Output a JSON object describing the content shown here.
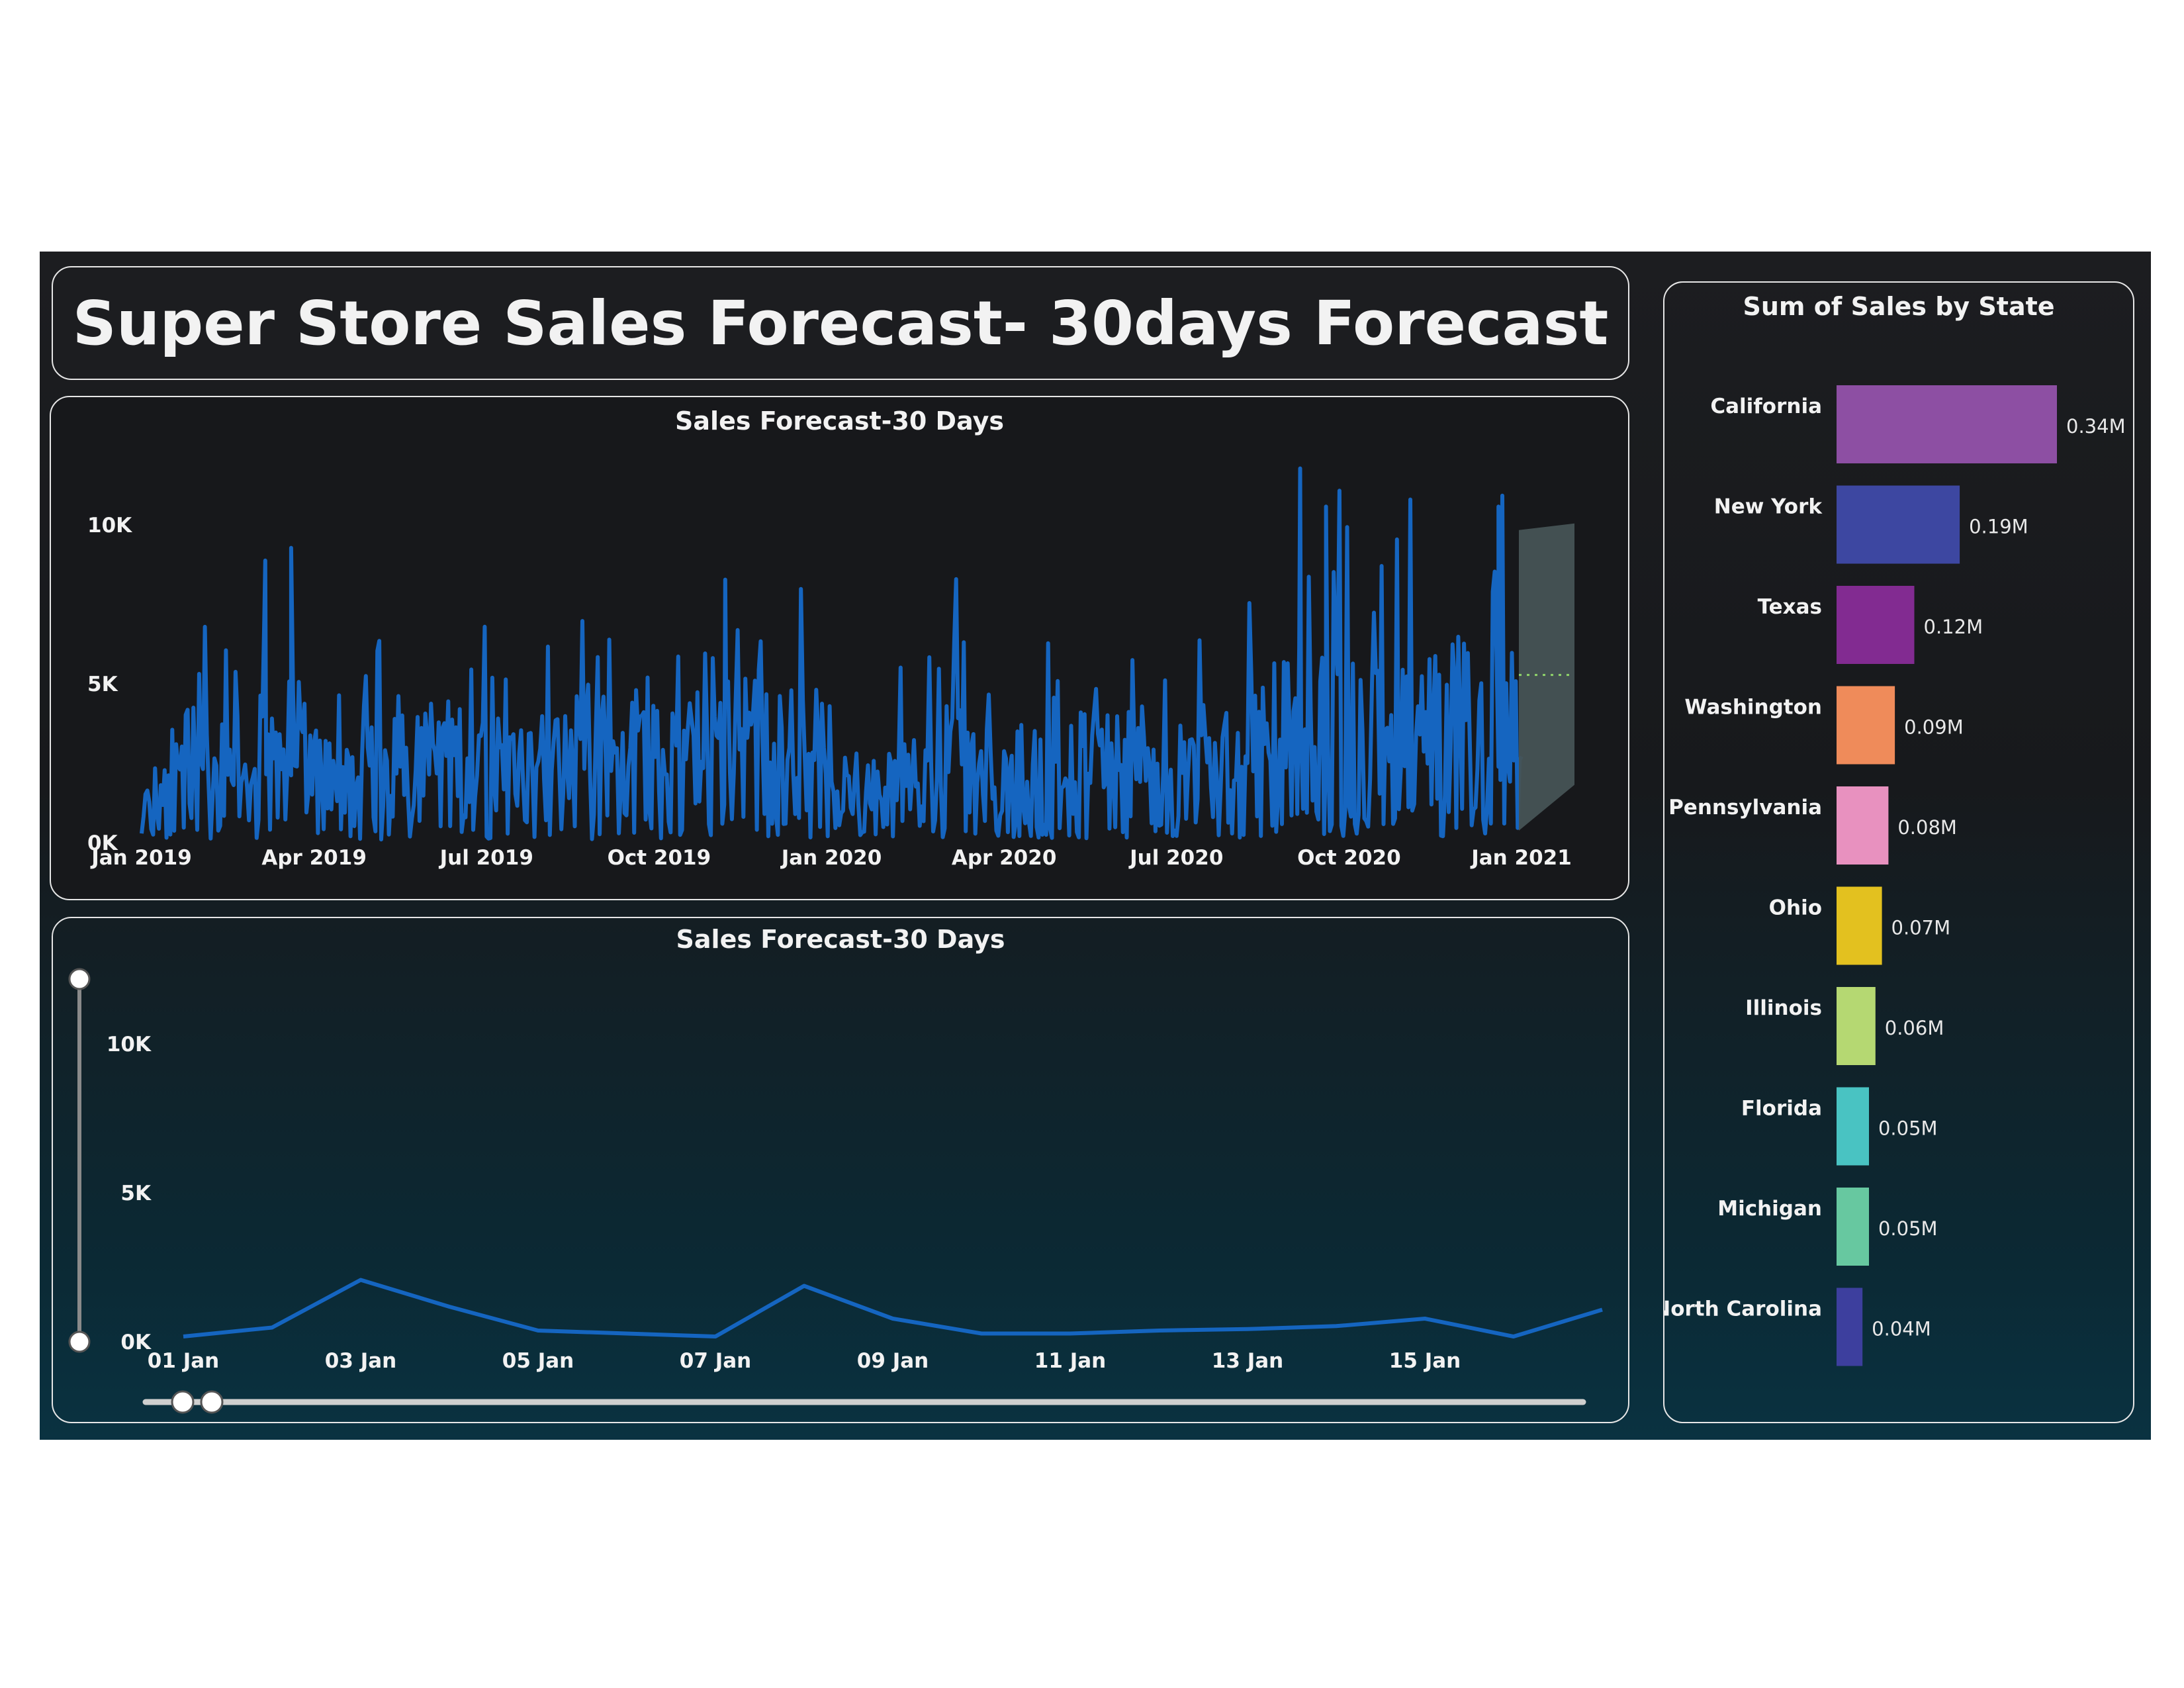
{
  "title": "Super Store Sales Forecast- 30days Forecast",
  "chart_data": [
    {
      "type": "line",
      "title": "Sales Forecast-30 Days",
      "x_range": [
        "Jan 2019",
        "Jan 2021"
      ],
      "x_ticks": [
        "Jan 2019",
        "Apr 2019",
        "Jul 2019",
        "Oct 2019",
        "Jan 2020",
        "Apr 2020",
        "Jul 2020",
        "Oct 2020",
        "Jan 2021"
      ],
      "y_ticks": [
        "0K",
        "5K",
        "10K"
      ],
      "ylim": [
        0,
        12000
      ],
      "series": [
        {
          "monthly_sample": [
            {
              "x": "Jan 2019",
              "y": 1500
            },
            {
              "x": "Feb 2019",
              "y": 2200
            },
            {
              "x": "Mar 2019",
              "y": 3000
            },
            {
              "x": "Apr 2019",
              "y": 1800
            },
            {
              "x": "May 2019",
              "y": 2300
            },
            {
              "x": "Jun 2019",
              "y": 2500
            },
            {
              "x": "Jul 2019",
              "y": 2000
            },
            {
              "x": "Aug 2019",
              "y": 2400
            },
            {
              "x": "Sep 2019",
              "y": 2800
            },
            {
              "x": "Oct 2019",
              "y": 2300
            },
            {
              "x": "Nov 2019",
              "y": 3100
            },
            {
              "x": "Dec 2019",
              "y": 3000
            },
            {
              "x": "Jan 2020",
              "y": 1700
            },
            {
              "x": "Feb 2020",
              "y": 1900
            },
            {
              "x": "Mar 2020",
              "y": 2700
            },
            {
              "x": "Apr 2020",
              "y": 2100
            },
            {
              "x": "May 2020",
              "y": 2500
            },
            {
              "x": "Jun 2020",
              "y": 2400
            },
            {
              "x": "Jul 2020",
              "y": 2200
            },
            {
              "x": "Aug 2020",
              "y": 2600
            },
            {
              "x": "Sep 2020",
              "y": 3600
            },
            {
              "x": "Oct 2020",
              "y": 3100
            },
            {
              "x": "Nov 2020",
              "y": 3900
            },
            {
              "x": "Dec 2020",
              "y": 3600
            }
          ],
          "peaks": [
            {
              "x": "Mar 2019",
              "y": 8900
            },
            {
              "x": "Mar 2019",
              "y": 9300
            },
            {
              "x": "Nov 2019",
              "y": 8300
            },
            {
              "x": "Sep 2020",
              "y": 10600
            },
            {
              "x": "Sep 2020",
              "y": 11800
            },
            {
              "x": "Dec 2020",
              "y": 10600
            }
          ]
        }
      ],
      "forecast": {
        "range": [
          "Jan 2021",
          "Jan 2021"
        ],
        "center": 5300,
        "lower": 800,
        "upper": 9900
      }
    },
    {
      "type": "line",
      "title": "Sales Forecast-30 Days",
      "x_ticks": [
        "01 Jan",
        "03 Jan",
        "05 Jan",
        "07 Jan",
        "09 Jan",
        "11 Jan",
        "13 Jan",
        "15 Jan"
      ],
      "y_ticks": [
        "0K",
        "5K",
        "10K"
      ],
      "ylim": [
        0,
        12000
      ],
      "series": [
        {
          "days": [
            1,
            2,
            3,
            4,
            5,
            6,
            7,
            8,
            9,
            10,
            11,
            12,
            13,
            14,
            15,
            16,
            17
          ],
          "values": [
            200,
            500,
            2100,
            1200,
            400,
            300,
            200,
            1900,
            800,
            300,
            300,
            400,
            450,
            550,
            800,
            200,
            1100
          ]
        }
      ]
    },
    {
      "type": "bar",
      "title": "Sum of Sales by State",
      "categories": [
        "California",
        "New York",
        "Texas",
        "Washington",
        "Pennsylvania",
        "Ohio",
        "Illinois",
        "Florida",
        "Michigan",
        "North Carolina"
      ],
      "values": [
        0.34,
        0.19,
        0.12,
        0.09,
        0.08,
        0.07,
        0.06,
        0.05,
        0.05,
        0.04
      ],
      "labels": [
        "0.34M",
        "0.19M",
        "0.12M",
        "0.09M",
        "0.08M",
        "0.07M",
        "0.06M",
        "0.05M",
        "0.05M",
        "0.04M"
      ],
      "colors": [
        "#8d4fa3",
        "#3d47a1",
        "#822b91",
        "#ef8b5a",
        "#e891bf",
        "#e3c11f",
        "#b5d872",
        "#49c3c2",
        "#67c8a0",
        "#3d3f9e"
      ]
    }
  ],
  "colors": {
    "line": "#1565c0",
    "forecast_band": "#465355",
    "forecast_line": "#8fd36a"
  }
}
